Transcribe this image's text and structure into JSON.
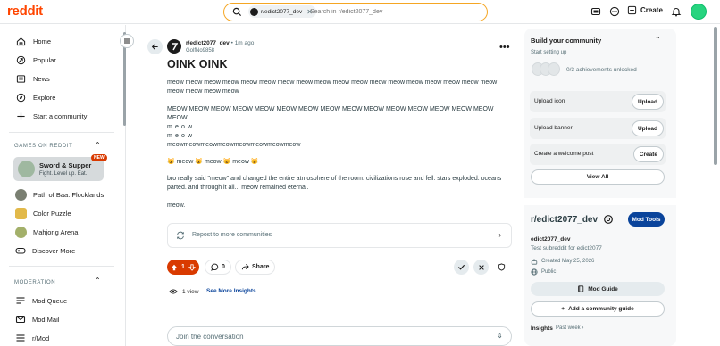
{
  "header": {
    "logo": "reddit",
    "search": {
      "chip_label": "r/edict2077_dev",
      "placeholder": "Search in r/edict2077_dev"
    },
    "create_label": "Create"
  },
  "sidebar": {
    "nav": [
      {
        "label": "Home",
        "icon": "home-icon"
      },
      {
        "label": "Popular",
        "icon": "popular-icon"
      },
      {
        "label": "News",
        "icon": "news-icon"
      },
      {
        "label": "Explore",
        "icon": "explore-icon"
      },
      {
        "label": "Start a community",
        "icon": "plus-icon"
      }
    ],
    "games_title": "GAMES ON REDDIT",
    "featured_game": {
      "name": "Sword & Supper",
      "tagline": "Fight. Level up. Eat.",
      "badge": "NEW"
    },
    "games": [
      {
        "label": "Path of Baa: Flocklands"
      },
      {
        "label": "Color Puzzle"
      },
      {
        "label": "Mahjong Arena"
      },
      {
        "label": "Discover More"
      }
    ],
    "moderation_title": "MODERATION",
    "moderation": [
      {
        "label": "Mod Queue"
      },
      {
        "label": "Mod Mail"
      },
      {
        "label": "r/Mod"
      }
    ]
  },
  "post": {
    "subreddit": "r/edict2077_dev",
    "time": "• 1m ago",
    "author": "GolfNo9858",
    "title": "OINK OINK",
    "paragraphs": [
      "meow meow meow meow meow meow meow meow meow meow meow meow meow meow meow meow meow meow meow meow meow meow",
      "MEOW MEOW MEOW MEOW MEOW MEOW MEOW MEOW MEOW MEOW MEOW MEOW MEOW MEOW MEOW MEOW",
      "m e o w",
      "m e o w",
      "meowmeowmeowmeowmeowmeowmeowmeow",
      "😺 meow 😺 meow 😺 meow 😺",
      "bro really said \"meow\" and changed the entire atmosphere of the room. civilizations rose and fell. stars exploded. oceans parted. and through it all... meow remained eternal.",
      "meow."
    ],
    "repost_label": "Repost to more communities",
    "score": "1",
    "comments": "0",
    "share_label": "Share",
    "views": "1 view",
    "insights_link": "See More Insights",
    "join_placeholder": "Join the conversation"
  },
  "right": {
    "build_title": "Build your community",
    "setup_label": "Start setting up",
    "achievements": "0/3 achievements unlocked",
    "tasks": [
      {
        "label": "Upload icon",
        "button": "Upload"
      },
      {
        "label": "Upload banner",
        "button": "Upload"
      },
      {
        "label": "Create a welcome post",
        "button": "Create"
      }
    ],
    "view_all": "View All",
    "community_name": "r/edict2077_dev",
    "mod_tools": "Mod Tools",
    "community_sub": "edict2077_dev",
    "community_desc": "Test subreddit for edict2077",
    "created": "Created May 25, 2026",
    "visibility": "Public",
    "mod_guide": "Mod Guide",
    "add_guide": "Add a community guide",
    "insights_label": "Insights",
    "insights_period": "Past week"
  },
  "colors": {
    "brand": "#ff4500",
    "upvote_active": "#d93a00",
    "mod_tools": "#0a449b",
    "search_border": "#f5a623"
  }
}
